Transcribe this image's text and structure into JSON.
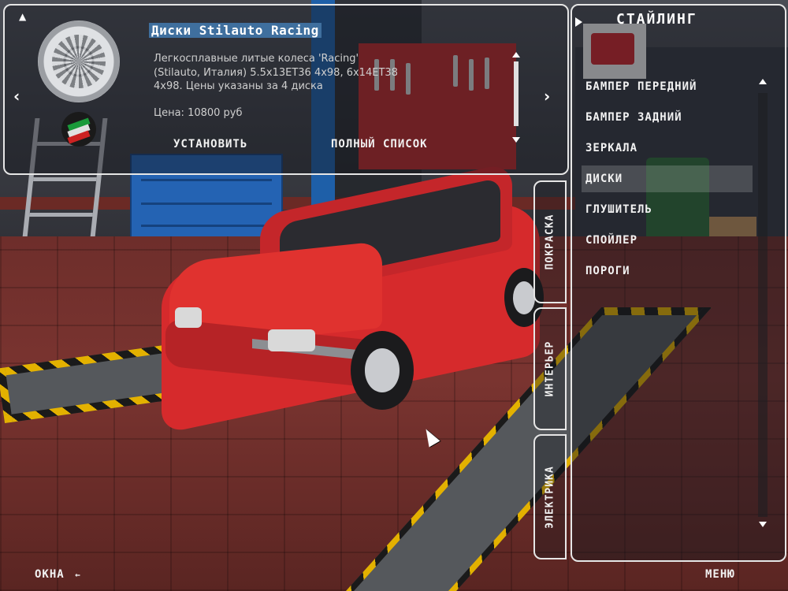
{
  "item": {
    "title": "Диски Stilauto Racing",
    "description": "Легкосплавные литые колеса 'Racing' (Stilauto, Италия) 5.5x13ET36 4x98, 6x14ET38 4x98. Цены указаны за 4 диска",
    "price": "Цена: 10800 руб",
    "install_label": "УСТАНОВИТЬ",
    "full_list_label": "ПОЛНЫЙ СПИСОК"
  },
  "side_tabs": [
    "ПОКРАСКА",
    "ИНТЕРЬЕР",
    "ЭЛЕКТРИКА"
  ],
  "styling_menu": {
    "title": "СТАЙЛИНГ",
    "items": [
      {
        "label": "БАМПЕР ПЕРЕДНИЙ",
        "selected": false
      },
      {
        "label": "БАМПЕР ЗАДНИЙ",
        "selected": false
      },
      {
        "label": "ЗЕРКАЛА",
        "selected": false
      },
      {
        "label": "ДИСКИ",
        "selected": true
      },
      {
        "label": "ГЛУШИТЕЛЬ",
        "selected": false
      },
      {
        "label": "СПОЙЛЕР",
        "selected": false
      },
      {
        "label": "ПОРОГИ",
        "selected": false
      }
    ]
  },
  "bottom": {
    "windows_label": "ОКНА",
    "windows_arrow": "←",
    "menu_label": "МЕНЮ"
  },
  "icons": {
    "collapse": "triangle-up-icon",
    "prev": "chevron-left-icon",
    "next": "chevron-right-icon",
    "menu_toggle": "play-icon"
  },
  "colors": {
    "selection_highlight": "#3f6f9e",
    "car": "#d62a2c",
    "panel_border": "#e6e6e6"
  }
}
